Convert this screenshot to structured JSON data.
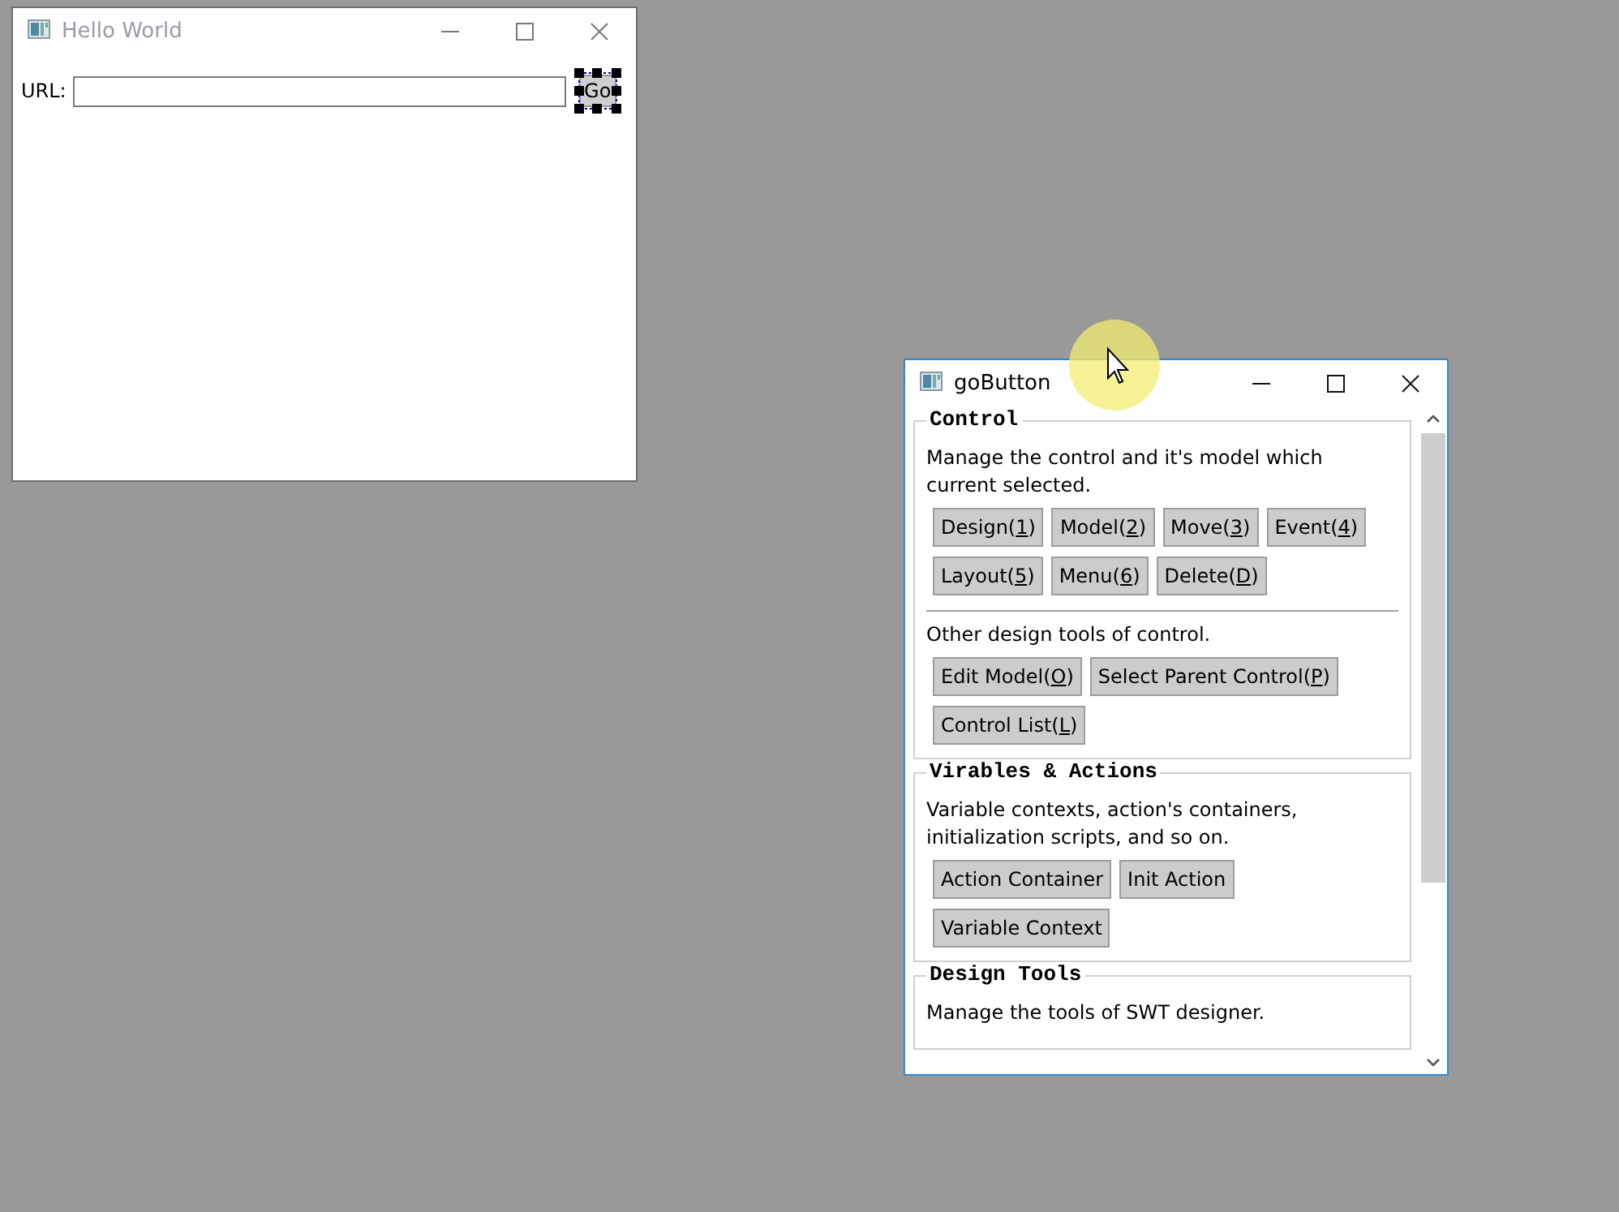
{
  "windows": [
    {
      "kind": "form",
      "title": "Hello World",
      "active": false,
      "url_label": "URL:",
      "go_button": {
        "label": "Go",
        "design_selected": true
      }
    },
    {
      "kind": "panel",
      "title": "goButton",
      "active": true,
      "groups": [
        {
          "title": "Control",
          "sections": [
            {
              "description": "Manage the control and it's model which current selected.",
              "buttons": [
                {
                  "text": "Design(",
                  "key": "1",
                  "tail": ")"
                },
                {
                  "text": "Model(",
                  "key": "2",
                  "tail": ")"
                },
                {
                  "text": "Move(",
                  "key": "3",
                  "tail": ")"
                },
                {
                  "text": "Event(",
                  "key": "4",
                  "tail": ")"
                },
                {
                  "text": "Layout(",
                  "key": "5",
                  "tail": ")"
                },
                {
                  "text": "Menu(",
                  "key": "6",
                  "tail": ")"
                },
                {
                  "text": "Delete(",
                  "key": "D",
                  "tail": ")"
                }
              ]
            },
            {
              "description": "Other design tools of control.",
              "buttons": [
                {
                  "text": "Edit Model(",
                  "key": "O",
                  "tail": ")"
                },
                {
                  "text": "Select Parent Control(",
                  "key": "P",
                  "tail": ")"
                },
                {
                  "text": "Control List(",
                  "key": "L",
                  "tail": ")"
                }
              ]
            }
          ]
        },
        {
          "title": "Virables & Actions",
          "sections": [
            {
              "description": "Variable contexts, action's containers, initialization scripts, and so on.",
              "buttons": [
                {
                  "text": "Action Container"
                },
                {
                  "text": "Init Action"
                },
                {
                  "text": "Variable Context"
                }
              ]
            }
          ]
        },
        {
          "title": "Design Tools",
          "sections": [
            {
              "description": "Manage the tools of SWT designer."
            }
          ]
        }
      ]
    }
  ]
}
